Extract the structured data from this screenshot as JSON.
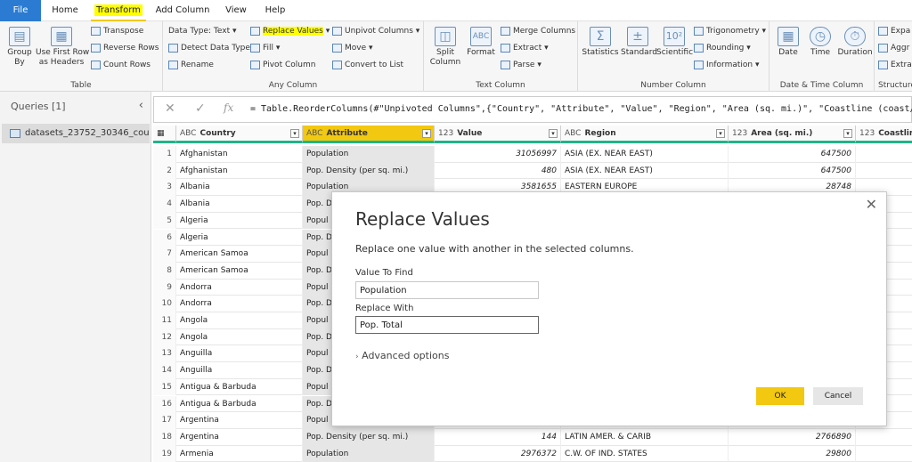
{
  "tabs": [
    "File",
    "Home",
    "Transform",
    "Add Column",
    "View",
    "Help"
  ],
  "ribbon": {
    "table_group": {
      "label": "Table",
      "group_by": "Group\nBy",
      "use_first_row": "Use First Row\nas Headers",
      "transpose": "Transpose",
      "reverse_rows": "Reverse Rows",
      "count_rows": "Count Rows"
    },
    "any_column": {
      "label": "Any Column",
      "data_type": "Data Type: Text",
      "detect": "Detect Data Type",
      "rename": "Rename",
      "replace_values": "Replace Values",
      "fill": "Fill",
      "pivot": "Pivot Column",
      "unpivot": "Unpivot Columns",
      "move": "Move",
      "convert": "Convert to List"
    },
    "text_column": {
      "label": "Text Column",
      "split": "Split\nColumn",
      "format": "Format",
      "merge": "Merge Columns",
      "extract": "Extract",
      "parse": "Parse"
    },
    "number_column": {
      "label": "Number Column",
      "statistics": "Statistics",
      "standard": "Standard",
      "scientific": "Scientific",
      "trig": "Trigonometry",
      "rounding": "Rounding",
      "information": "Information"
    },
    "datetime": {
      "label": "Date & Time Column",
      "date": "Date",
      "time": "Time",
      "duration": "Duration"
    },
    "structured": {
      "label": "Structure",
      "expand": "Expa",
      "aggregate": "Aggr",
      "extract": "Extra"
    }
  },
  "queries": {
    "title": "Queries [1]",
    "item": "datasets_23752_30346_cou..."
  },
  "formula": "= Table.ReorderColumns(#\"Unpivoted Columns\",{\"Country\", \"Attribute\", \"Value\", \"Region\", \"Area (sq. mi.)\", \"Coastline (coast/are",
  "columns": [
    {
      "type": "ABC",
      "name": "Country"
    },
    {
      "type": "ABC",
      "name": "Attribute"
    },
    {
      "type": "123",
      "name": "Value"
    },
    {
      "type": "ABC",
      "name": "Region"
    },
    {
      "type": "123",
      "name": "Area (sq. mi.)"
    },
    {
      "type": "123",
      "name": "Coastline"
    }
  ],
  "rows": [
    [
      "1",
      "Afghanistan",
      "Population",
      "31056997",
      "ASIA (EX. NEAR EAST)",
      "647500"
    ],
    [
      "2",
      "Afghanistan",
      "Pop. Density (per sq. mi.)",
      "480",
      "ASIA (EX. NEAR EAST)",
      "647500"
    ],
    [
      "3",
      "Albania",
      "Population",
      "3581655",
      "EASTERN EUROPE",
      "28748"
    ],
    [
      "4",
      "Albania",
      "Pop. D",
      "",
      "",
      ""
    ],
    [
      "5",
      "Algeria",
      "Popul",
      "",
      "",
      ""
    ],
    [
      "6",
      "Algeria",
      "Pop. D",
      "",
      "",
      ""
    ],
    [
      "7",
      "American Samoa",
      "Popul",
      "",
      "",
      ""
    ],
    [
      "8",
      "American Samoa",
      "Pop. D",
      "",
      "",
      ""
    ],
    [
      "9",
      "Andorra",
      "Popul",
      "",
      "",
      ""
    ],
    [
      "10",
      "Andorra",
      "Pop. D",
      "",
      "",
      ""
    ],
    [
      "11",
      "Angola",
      "Popul",
      "",
      "",
      ""
    ],
    [
      "12",
      "Angola",
      "Pop. D",
      "",
      "",
      ""
    ],
    [
      "13",
      "Anguilla",
      "Popul",
      "",
      "",
      ""
    ],
    [
      "14",
      "Anguilla",
      "Pop. D",
      "",
      "",
      ""
    ],
    [
      "15",
      "Antigua & Barbuda",
      "Popul",
      "",
      "",
      ""
    ],
    [
      "16",
      "Antigua & Barbuda",
      "Pop. D",
      "",
      "",
      ""
    ],
    [
      "17",
      "Argentina",
      "Popul",
      "",
      "",
      ""
    ],
    [
      "18",
      "Argentina",
      "Pop. Density (per sq. mi.)",
      "144",
      "LATIN AMER. & CARIB",
      "2766890"
    ],
    [
      "19",
      "Armenia",
      "Population",
      "2976372",
      "C.W. OF IND. STATES",
      "29800"
    ]
  ],
  "dialog": {
    "title": "Replace Values",
    "description": "Replace one value with another in the selected columns.",
    "find_label": "Value To Find",
    "find_value": "Population",
    "replace_label": "Replace With",
    "replace_value": "Pop. Total",
    "advanced": "Advanced options",
    "ok": "OK",
    "cancel": "Cancel"
  },
  "colors": {
    "accent": "#f2c811",
    "file_tab": "#2b7bd2",
    "highlight": "#ffff00",
    "column_quality": "#21b38a"
  }
}
